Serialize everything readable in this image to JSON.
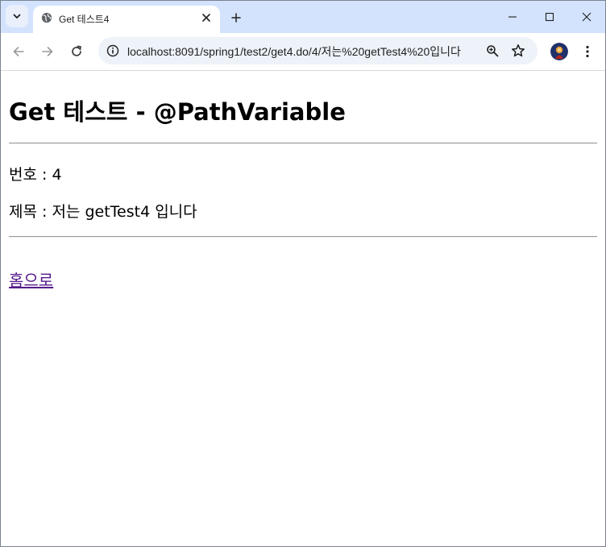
{
  "browser": {
    "tab_title": "Get 테스트4",
    "url": "localhost:8091/spring1/test2/get4.do/4/저는%20getTest4%20입니다"
  },
  "page": {
    "heading": "Get 테스트 - @PathVariable",
    "number_label": "번호 : ",
    "number_value": "4",
    "title_label": "제목 : ",
    "title_value": "저는 getTest4 입니다",
    "home_link": "홈으로"
  },
  "colors": {
    "tabstrip": "#d3e3fd",
    "visited_link": "#551a8b"
  }
}
